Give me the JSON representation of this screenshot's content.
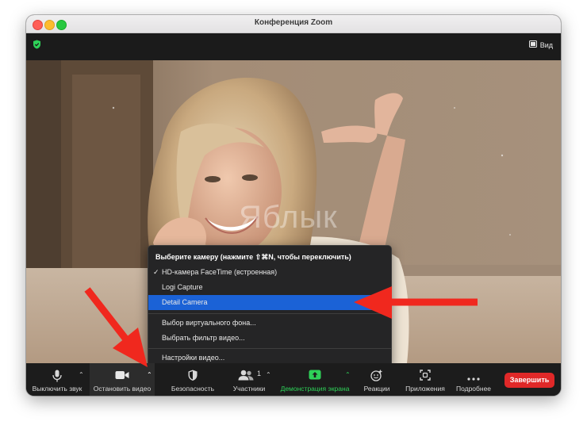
{
  "window": {
    "title": "Конференция Zoom",
    "view_label": "Вид"
  },
  "video": {
    "watermark": "Яблык"
  },
  "camera_menu": {
    "header": "Выберите камеру (нажмите ⇧⌘N, чтобы переключить)",
    "items": [
      {
        "label": "HD-камера FaceTime (встроенная)",
        "checked": true,
        "selected": false
      },
      {
        "label": "Logi Capture",
        "checked": false,
        "selected": false
      },
      {
        "label": "Detail Camera",
        "checked": false,
        "selected": true
      }
    ],
    "check_mark": "✓",
    "background_item": "Выбор виртуального фона...",
    "filter_item": "Выбрать фильтр видео...",
    "settings_item": "Настройки видео..."
  },
  "toolbar": {
    "mute_label": "Выключить звук",
    "stop_video_label": "Остановить видео",
    "security_label": "Безопасность",
    "participants_label": "Участники",
    "participants_count": "1",
    "share_label": "Демонстрация экрана",
    "reactions_label": "Реакции",
    "apps_label": "Приложения",
    "more_label": "Подробнее",
    "end_label": "Завершить"
  },
  "colors": {
    "accent": "#1b62d6",
    "share_green": "#2ed158",
    "end_red": "#e02828",
    "shield_green": "#2ed158",
    "annotation_arrow": "#f0281e"
  }
}
